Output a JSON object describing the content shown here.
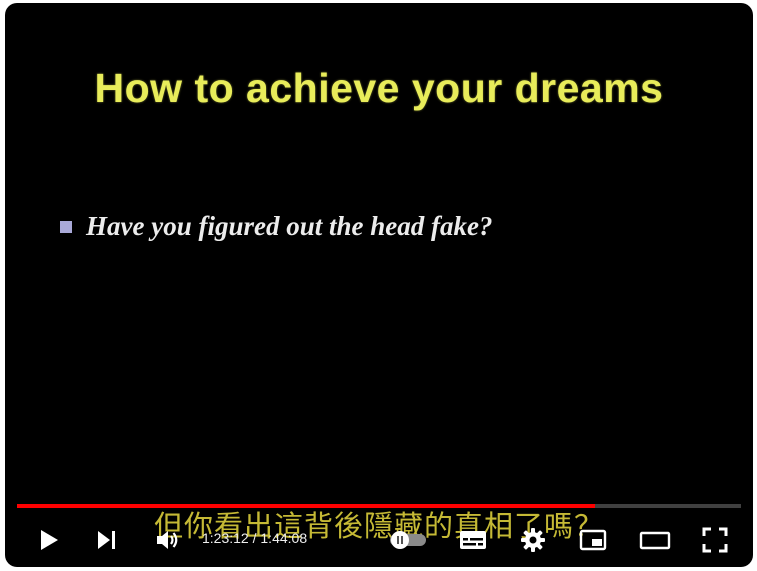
{
  "slide": {
    "title": "How to achieve your dreams",
    "bullet": "Have you figured out the head fake?"
  },
  "subtitle": "但你看出這背後隱藏的真相了嗎？",
  "player": {
    "current_time": "1:23:12",
    "separator": " / ",
    "duration": "1:44:08",
    "progress_fraction": 0.799,
    "progress_color": "#ff0000"
  },
  "controls": {
    "icons": [
      "play-icon",
      "next-icon",
      "volume-icon",
      "autoplay-toggle-icon",
      "subtitles-icon",
      "settings-gear-icon",
      "miniplayer-icon",
      "theater-mode-icon",
      "fullscreen-icon"
    ]
  },
  "colors": {
    "title": "#e8ec5a",
    "bullet_square": "#a9a9d8",
    "subtitle": "#d6c93a"
  }
}
